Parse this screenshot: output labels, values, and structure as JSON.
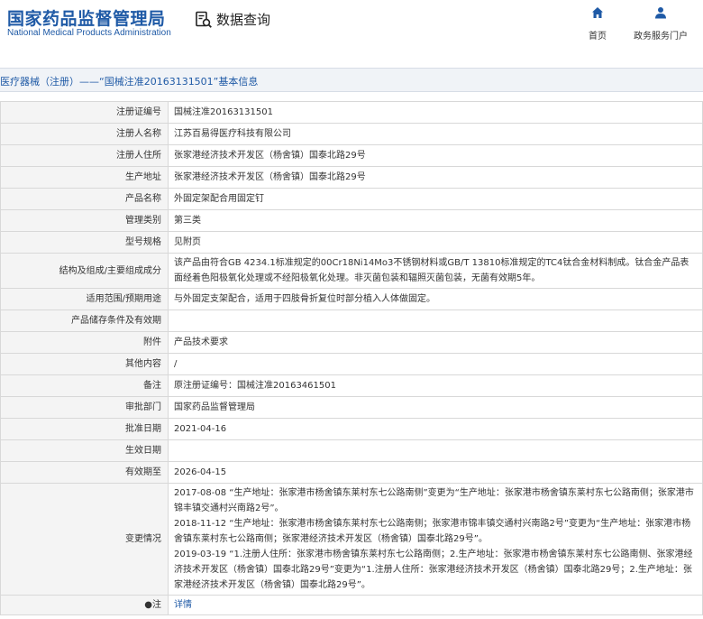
{
  "header": {
    "logo_cn": "国家药品监督管理局",
    "logo_en": "National Medical Products Administration",
    "query_label": "数据查询",
    "nav": [
      {
        "label": "首页",
        "icon": "home-icon"
      },
      {
        "label": "政务服务门户",
        "icon": "user-icon"
      }
    ]
  },
  "breadcrumb": "医疗器械（注册）——“国械注准20163131501”基本信息",
  "rows": [
    {
      "label": "注册证编号",
      "value": "国械注准20163131501"
    },
    {
      "label": "注册人名称",
      "value": "江苏百易得医疗科技有限公司"
    },
    {
      "label": "注册人住所",
      "value": "张家港经济技术开发区（杨舍镇）国泰北路29号"
    },
    {
      "label": "生产地址",
      "value": "张家港经济技术开发区（杨舍镇）国泰北路29号"
    },
    {
      "label": "产品名称",
      "value": "外固定架配合用固定钉"
    },
    {
      "label": "管理类别",
      "value": "第三类"
    },
    {
      "label": "型号规格",
      "value": "见附页"
    },
    {
      "label": "结构及组成/主要组成成分",
      "value": "该产品由符合GB 4234.1标准规定的00Cr18Ni14Mo3不锈钢材料或GB/T 13810标准规定的TC4钛合金材料制成。钛合金产品表面经着色阳极氧化处理或不经阳极氧化处理。非灭菌包装和辐照灭菌包装，无菌有效期5年。"
    },
    {
      "label": "适用范围/预期用途",
      "value": "与外固定支架配合，适用于四肢骨折复位时部分植入人体做固定。"
    },
    {
      "label": "产品储存条件及有效期",
      "value": ""
    },
    {
      "label": "附件",
      "value": "产品技术要求"
    },
    {
      "label": "其他内容",
      "value": "/"
    },
    {
      "label": "备注",
      "value": "原注册证编号：国械注准20163461501"
    },
    {
      "label": "审批部门",
      "value": "国家药品监督管理局"
    },
    {
      "label": "批准日期",
      "value": "2021-04-16"
    },
    {
      "label": "生效日期",
      "value": ""
    },
    {
      "label": "有效期至",
      "value": "2026-04-15"
    }
  ],
  "changes": {
    "label": "变更情况",
    "entries": [
      "2017-08-08 “生产地址：张家港市杨舍镇东莱村东七公路南侧”变更为“生产地址：张家港市杨舍镇东莱村东七公路南侧；张家港市锦丰镇交通村兴南路2号”。",
      "2018-11-12 “生产地址：张家港市杨舍镇东莱村东七公路南侧；张家港市锦丰镇交通村兴南路2号”变更为“生产地址：张家港市杨舍镇东莱村东七公路南侧；张家港经济技术开发区（杨舍镇）国泰北路29号”。",
      "2019-03-19 “1.注册人住所：张家港市杨舍镇东莱村东七公路南侧；2.生产地址：张家港市杨舍镇东莱村东七公路南侧、张家港经济技术开发区（杨舍镇）国泰北路29号”变更为“1.注册人住所：张家港经济技术开发区（杨舍镇）国泰北路29号；2.生产地址：张家港经济技术开发区（杨舍镇）国泰北路29号”。"
    ]
  },
  "note": {
    "label": "●注",
    "link": "详情"
  },
  "colors": {
    "brand": "#1f5aa6",
    "label_bg": "#f4f4f4",
    "border": "#d8d8d8",
    "bar_bg": "#f0f3f7"
  }
}
